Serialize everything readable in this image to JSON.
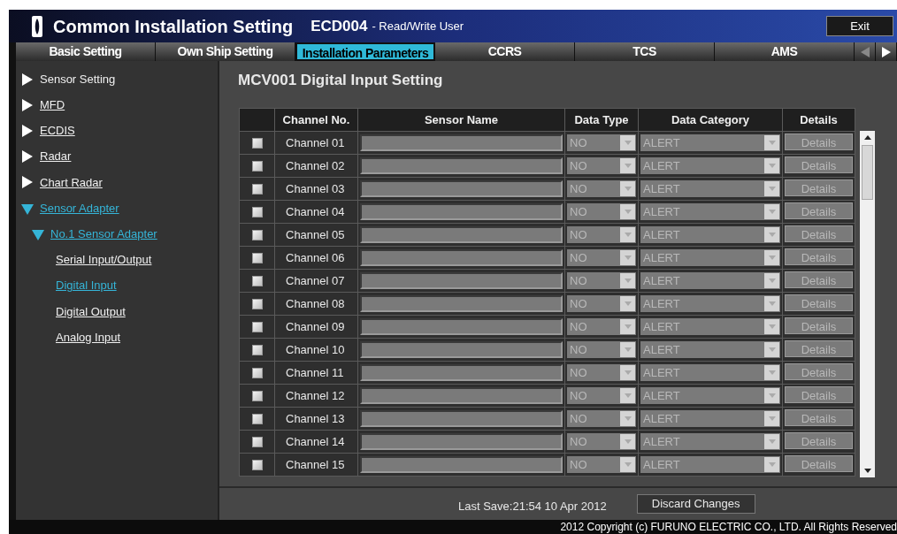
{
  "window": {
    "title": "Common Installation Setting",
    "device": "ECD004",
    "user": "- Read/Write User",
    "exit": "Exit"
  },
  "tabs": [
    {
      "label": "Basic Setting",
      "selected": false
    },
    {
      "label": "Own Ship Setting",
      "selected": false
    },
    {
      "label": "Installation Parameters",
      "selected": true
    },
    {
      "label": "CCRS",
      "selected": false
    },
    {
      "label": "TCS",
      "selected": false
    },
    {
      "label": "AMS",
      "selected": false
    }
  ],
  "tab_scroll": {
    "left": {
      "disabled": true
    },
    "right": {
      "disabled": false
    }
  },
  "sidebar": {
    "items": [
      {
        "label": "Sensor Setting",
        "kind": "folder",
        "link": false,
        "expanded": false,
        "selected": false
      },
      {
        "label": "MFD",
        "kind": "folder",
        "link": true,
        "expanded": false,
        "selected": false
      },
      {
        "label": "ECDIS",
        "kind": "folder",
        "link": true,
        "expanded": false,
        "selected": false
      },
      {
        "label": "Radar",
        "kind": "folder",
        "link": true,
        "expanded": false,
        "selected": false
      },
      {
        "label": "Chart Radar",
        "kind": "folder",
        "link": true,
        "expanded": false,
        "selected": false
      },
      {
        "label": "Sensor Adapter",
        "kind": "folder",
        "link": true,
        "expanded": true,
        "selected": true,
        "children": [
          {
            "label": "No.1 Sensor Adapter",
            "kind": "folder",
            "link": true,
            "expanded": true,
            "selected": true,
            "children": [
              {
                "label": "Serial Input/Output",
                "kind": "page",
                "link": true,
                "selected": false
              },
              {
                "label": "Digital Input",
                "kind": "page",
                "link": true,
                "selected": true
              },
              {
                "label": "Digital Output",
                "kind": "page",
                "link": true,
                "selected": false
              },
              {
                "label": "Analog Input",
                "kind": "page",
                "link": true,
                "selected": false
              }
            ]
          }
        ]
      }
    ]
  },
  "page": {
    "title": "MCV001 Digital Input Setting"
  },
  "table": {
    "columns": [
      "",
      "Channel No.",
      "Sensor Name",
      "Data Type",
      "Data Category",
      "Details"
    ],
    "rows": [
      {
        "checked": false,
        "channel": "Channel 01",
        "data_type": "NO",
        "data_category": "ALERT",
        "details": "Details"
      },
      {
        "checked": false,
        "channel": "Channel 02",
        "data_type": "NO",
        "data_category": "ALERT",
        "details": "Details"
      },
      {
        "checked": false,
        "channel": "Channel 03",
        "data_type": "NO",
        "data_category": "ALERT",
        "details": "Details"
      },
      {
        "checked": false,
        "channel": "Channel 04",
        "data_type": "NO",
        "data_category": "ALERT",
        "details": "Details"
      },
      {
        "checked": false,
        "channel": "Channel 05",
        "data_type": "NO",
        "data_category": "ALERT",
        "details": "Details"
      },
      {
        "checked": false,
        "channel": "Channel 06",
        "data_type": "NO",
        "data_category": "ALERT",
        "details": "Details"
      },
      {
        "checked": false,
        "channel": "Channel 07",
        "data_type": "NO",
        "data_category": "ALERT",
        "details": "Details"
      },
      {
        "checked": false,
        "channel": "Channel 08",
        "data_type": "NO",
        "data_category": "ALERT",
        "details": "Details"
      },
      {
        "checked": false,
        "channel": "Channel 09",
        "data_type": "NO",
        "data_category": "ALERT",
        "details": "Details"
      },
      {
        "checked": false,
        "channel": "Channel 10",
        "data_type": "NO",
        "data_category": "ALERT",
        "details": "Details"
      },
      {
        "checked": false,
        "channel": "Channel 11",
        "data_type": "NO",
        "data_category": "ALERT",
        "details": "Details"
      },
      {
        "checked": false,
        "channel": "Channel 12",
        "data_type": "NO",
        "data_category": "ALERT",
        "details": "Details"
      },
      {
        "checked": false,
        "channel": "Channel 13",
        "data_type": "NO",
        "data_category": "ALERT",
        "details": "Details"
      },
      {
        "checked": false,
        "channel": "Channel 14",
        "data_type": "NO",
        "data_category": "ALERT",
        "details": "Details"
      },
      {
        "checked": false,
        "channel": "Channel 15",
        "data_type": "NO",
        "data_category": "ALERT",
        "details": "Details"
      }
    ]
  },
  "footer": {
    "last_save": "Last Save:21:54 10 Apr 2012",
    "discard": "Discard Changes"
  },
  "status_bar": {
    "copyright": "2012 Copyright (c) FURUNO ELECTRIC CO., LTD. All Rights Reserved"
  }
}
